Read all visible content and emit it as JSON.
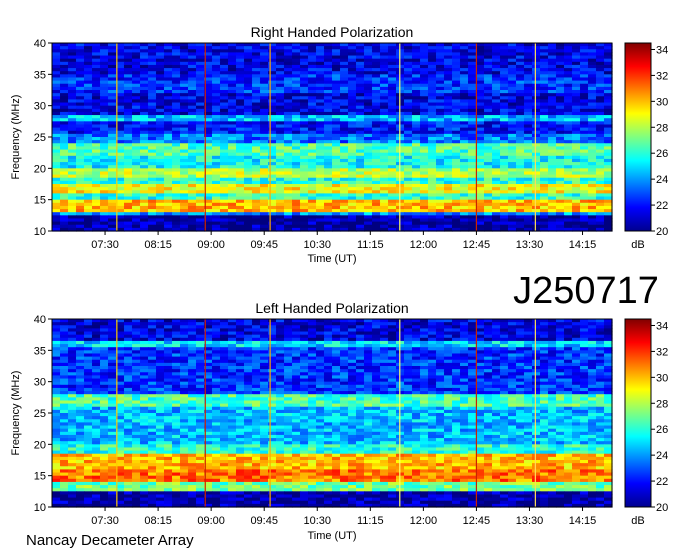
{
  "chart_data": [
    {
      "type": "heatmap",
      "title": "Right Handed Polarization",
      "xlabel": "Time (UT)",
      "ylabel": "Frequency (MHz)",
      "x_ticks": [
        "07:30",
        "08:15",
        "09:00",
        "09:45",
        "10:30",
        "11:15",
        "12:00",
        "12:45",
        "13:30",
        "14:15"
      ],
      "x_range": [
        "06:45",
        "14:40"
      ],
      "y_ticks": [
        10,
        15,
        20,
        25,
        30,
        35,
        40
      ],
      "ylim": [
        10,
        40
      ],
      "colorbar": {
        "ticks": [
          20,
          22,
          24,
          26,
          28,
          30,
          32,
          34
        ],
        "range": [
          20,
          34.5
        ],
        "label": "dB"
      },
      "bands": [
        {
          "from": 10,
          "to": 12.5,
          "level": 20.5
        },
        {
          "from": 12.5,
          "to": 13.2,
          "level": 24
        },
        {
          "from": 13.2,
          "to": 14.8,
          "level": 30
        },
        {
          "from": 14.8,
          "to": 16,
          "level": 26
        },
        {
          "from": 16,
          "to": 17.5,
          "level": 29
        },
        {
          "from": 17.5,
          "to": 18.5,
          "level": 26
        },
        {
          "from": 18.5,
          "to": 20,
          "level": 28
        },
        {
          "from": 20,
          "to": 22,
          "level": 25.5
        },
        {
          "from": 22,
          "to": 24,
          "level": 26.5
        },
        {
          "from": 24,
          "to": 25.5,
          "level": 23.5
        },
        {
          "from": 25.5,
          "to": 27.5,
          "level": 22
        },
        {
          "from": 27.5,
          "to": 28.5,
          "level": 24.5
        },
        {
          "from": 28.5,
          "to": 32,
          "level": 21.5
        },
        {
          "from": 32,
          "to": 35,
          "level": 22.5
        },
        {
          "from": 35,
          "to": 40,
          "level": 21.5
        }
      ],
      "vertical_markers": [
        "07:40",
        "08:55",
        "09:50",
        "11:40",
        "12:45",
        "13:35"
      ]
    },
    {
      "type": "heatmap",
      "title": "Left Handed Polarization",
      "xlabel": "Time (UT)",
      "ylabel": "Frequency (MHz)",
      "x_ticks": [
        "07:30",
        "08:15",
        "09:00",
        "09:45",
        "10:30",
        "11:15",
        "12:00",
        "12:45",
        "13:30",
        "14:15"
      ],
      "x_range": [
        "06:45",
        "14:40"
      ],
      "y_ticks": [
        10,
        15,
        20,
        25,
        30,
        35,
        40
      ],
      "ylim": [
        10,
        40
      ],
      "colorbar": {
        "ticks": [
          20,
          22,
          24,
          26,
          28,
          30,
          32,
          34
        ],
        "range": [
          20,
          34.5
        ],
        "label": "dB"
      },
      "bands": [
        {
          "from": 10,
          "to": 12.5,
          "level": 20.5
        },
        {
          "from": 12.5,
          "to": 14,
          "level": 27
        },
        {
          "from": 14,
          "to": 16,
          "level": 31
        },
        {
          "from": 16,
          "to": 18.5,
          "level": 30
        },
        {
          "from": 18.5,
          "to": 20,
          "level": 26
        },
        {
          "from": 20,
          "to": 22,
          "level": 24.5
        },
        {
          "from": 22,
          "to": 26,
          "level": 24.5
        },
        {
          "from": 26,
          "to": 28,
          "level": 26.5
        },
        {
          "from": 28,
          "to": 35.5,
          "level": 22.5
        },
        {
          "from": 35.5,
          "to": 36.5,
          "level": 25
        },
        {
          "from": 36.5,
          "to": 40,
          "level": 21.5
        }
      ],
      "vertical_markers": [
        "07:40",
        "08:55",
        "09:50",
        "11:40",
        "12:45",
        "13:35"
      ]
    }
  ],
  "labels": {
    "observation_id": "J250717",
    "instrument": "Nancay Decameter Array"
  }
}
